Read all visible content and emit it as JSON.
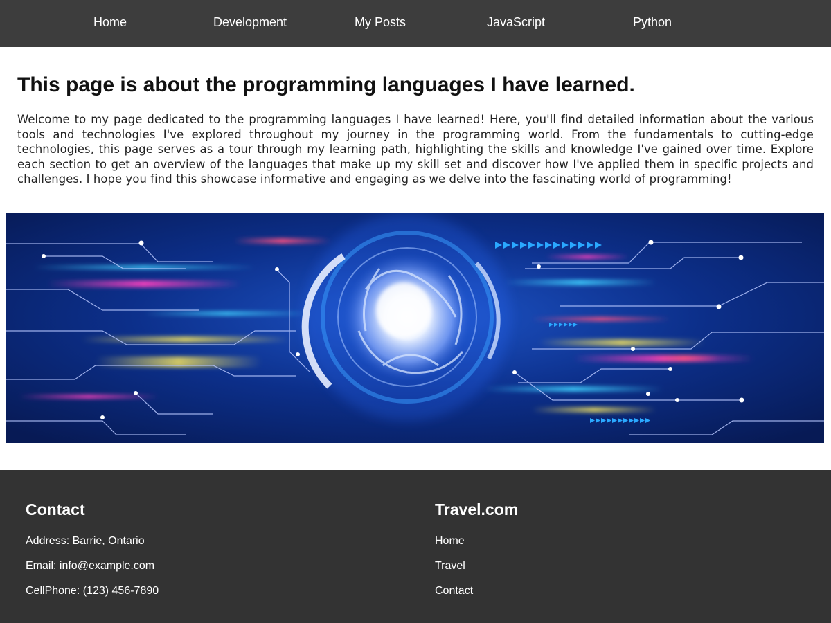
{
  "nav": {
    "items": [
      {
        "label": "Home"
      },
      {
        "label": "Development"
      },
      {
        "label": "My Posts"
      },
      {
        "label": "JavaScript"
      },
      {
        "label": "Python"
      }
    ]
  },
  "main": {
    "title": "This page is about the programming languages I have learned.",
    "intro": "Welcome to my page dedicated to the programming languages I have learned! Here, you'll find detailed information about the various tools and technologies I've explored throughout my journey in the programming world. From the fundamentals to cutting-edge technologies, this page serves as a tour through my learning path, highlighting the skills and knowledge I've gained over time. Explore each section to get an overview of the languages that make up my skill set and discover how I've applied them in specific projects and challenges. I hope you find this showcase informative and engaging as we delve into the fascinating world of programming!",
    "hero_image": "technology-circuit-banner"
  },
  "footer": {
    "contact": {
      "heading": "Contact",
      "address": "Address: Barrie, Ontario",
      "email": "Email: info@example.com",
      "phone": "CellPhone: (123) 456-7890"
    },
    "travel": {
      "heading": "Travel.com",
      "links": [
        {
          "label": "Home"
        },
        {
          "label": "Travel"
        },
        {
          "label": "Contact"
        }
      ]
    }
  },
  "colors": {
    "nav_bg": "#3d3d3d",
    "footer_bg": "#333333",
    "hero_bg": "#0a2a78"
  }
}
